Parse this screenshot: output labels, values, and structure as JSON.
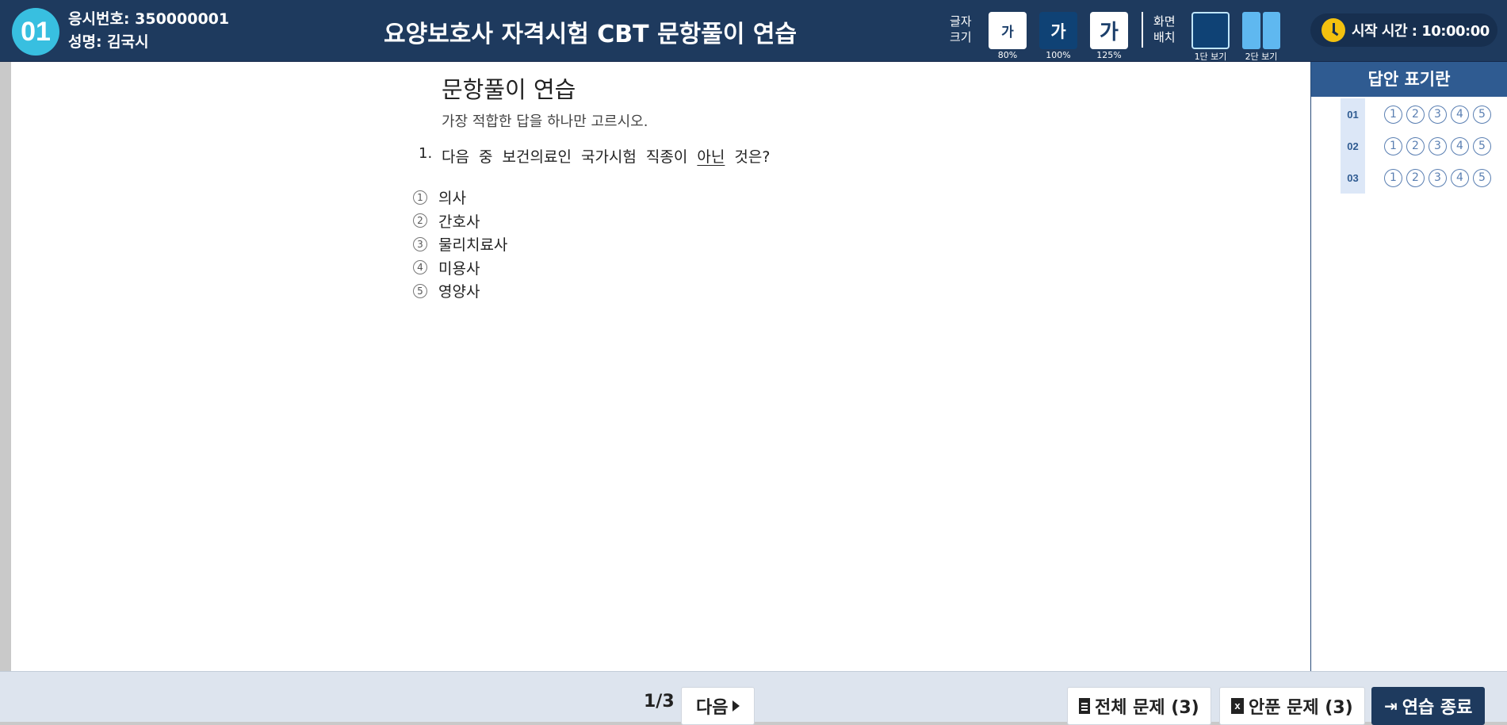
{
  "header": {
    "exam_badge": "01",
    "exam_number": "응시번호: 350000001",
    "exam_name": "성명: 김국시",
    "title": "요양보호사 자격시험 CBT 문항풀이 연습",
    "font_size_label": [
      "글자",
      "크기"
    ],
    "font_sizes": [
      {
        "glyph": "가",
        "label": "80%"
      },
      {
        "glyph": "가",
        "label": "100%"
      },
      {
        "glyph": "가",
        "label": "125%"
      }
    ],
    "layout_label": [
      "화면",
      "배치"
    ],
    "layout_options": [
      "1단 보기",
      "2단 보기"
    ],
    "timer_text": "시작 시간 : 10:00:00"
  },
  "question": {
    "page_title": "문항풀이 연습",
    "instruction": "가장 적합한 답을 하나만 고르시오.",
    "number": "1.",
    "text_before": "다음 중 보건의료인 국가시험 직종이",
    "text_underlined": "아닌",
    "text_after": "것은?",
    "choices": [
      {
        "mark": "1",
        "label": "의사"
      },
      {
        "mark": "2",
        "label": "간호사"
      },
      {
        "mark": "3",
        "label": "물리치료사"
      },
      {
        "mark": "4",
        "label": "미용사"
      },
      {
        "mark": "5",
        "label": "영양사"
      }
    ]
  },
  "answer_sheet": {
    "title": "답안 표기란",
    "rows": [
      {
        "num": "01",
        "options": [
          "1",
          "2",
          "3",
          "4",
          "5"
        ]
      },
      {
        "num": "02",
        "options": [
          "1",
          "2",
          "3",
          "4",
          "5"
        ]
      },
      {
        "num": "03",
        "options": [
          "1",
          "2",
          "3",
          "4",
          "5"
        ]
      }
    ]
  },
  "footer": {
    "page_indicator": "1/3",
    "next_label": "다음",
    "all_questions_label": "전체 문제 (3)",
    "unsolved_label": "안푼 문제 (3)",
    "exit_label": "연습 종료"
  },
  "colors": {
    "header_bg": "#1e3a5e",
    "badge": "#38bfe0",
    "answer_head": "#2f5b91",
    "clock": "#f3c10f"
  },
  "icons": [
    "clock-icon",
    "document-icon",
    "excel-icon",
    "exit-icon",
    "caret-right-icon"
  ]
}
